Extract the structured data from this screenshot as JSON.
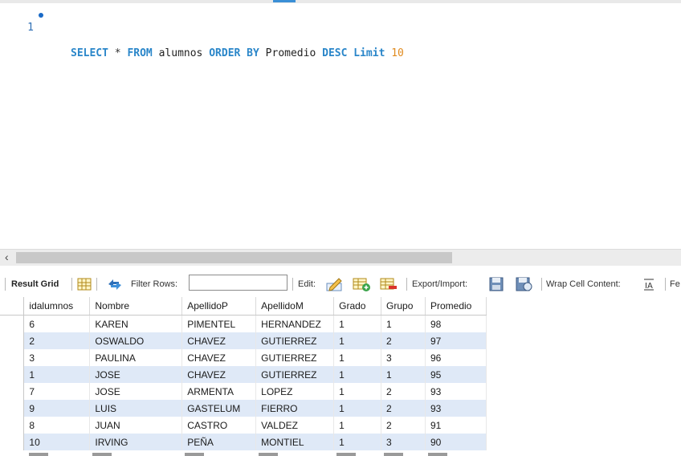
{
  "editor": {
    "line_number": "1",
    "tokens": {
      "select": "SELECT",
      "star": "*",
      "from": "FROM",
      "table": "alumnos",
      "orderby": "ORDER BY",
      "column": "Promedio",
      "desc": "DESC",
      "limit": "Limit",
      "limit_value": "10"
    }
  },
  "toolbar": {
    "result_grid": "Result Grid",
    "filter_rows": "Filter Rows:",
    "filter_value": "",
    "edit": "Edit:",
    "export_import": "Export/Import:",
    "wrap_cell": "Wrap Cell Content:",
    "fetch_truncated": "Fe"
  },
  "grid": {
    "headers": [
      "idalumnos",
      "Nombre",
      "ApellidoP",
      "ApellidoM",
      "Grado",
      "Grupo",
      "Promedio"
    ],
    "rows": [
      [
        "6",
        "KAREN",
        "PIMENTEL",
        "HERNANDEZ",
        "1",
        "1",
        "98"
      ],
      [
        "2",
        "OSWALDO",
        "CHAVEZ",
        "GUTIERREZ",
        "1",
        "2",
        "97"
      ],
      [
        "3",
        "PAULINA",
        "CHAVEZ",
        "GUTIERREZ",
        "1",
        "3",
        "96"
      ],
      [
        "1",
        "JOSE",
        "CHAVEZ",
        "GUTIERREZ",
        "1",
        "1",
        "95"
      ],
      [
        "7",
        "JOSE",
        "ARMENTA",
        "LOPEZ",
        "1",
        "2",
        "93"
      ],
      [
        "9",
        "LUIS",
        "GASTELUM",
        "FIERRO",
        "1",
        "2",
        "93"
      ],
      [
        "8",
        "JUAN",
        "CASTRO",
        "VALDEZ",
        "1",
        "2",
        "91"
      ],
      [
        "10",
        "IRVING",
        "PEÑA",
        "MONTIEL",
        "1",
        "3",
        "90"
      ]
    ]
  },
  "colors": {
    "keyword": "#2a86c9",
    "number": "#e08a1e",
    "alt_row": "#dfe9f7"
  }
}
